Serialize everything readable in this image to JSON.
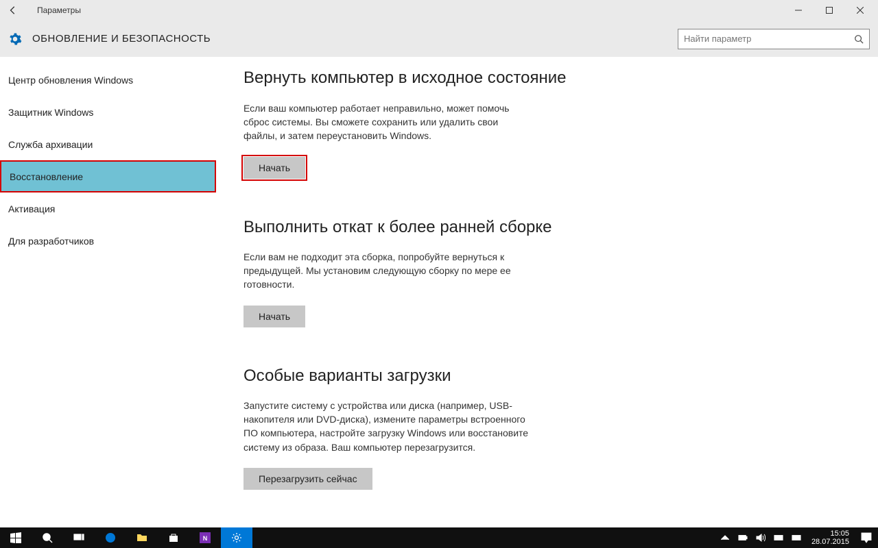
{
  "titlebar": {
    "title": "Параметры"
  },
  "header": {
    "title": "ОБНОВЛЕНИЕ И БЕЗОПАСНОСТЬ"
  },
  "search": {
    "placeholder": "Найти параметр"
  },
  "sidebar": {
    "items": [
      {
        "label": "Центр обновления Windows"
      },
      {
        "label": "Защитник Windows"
      },
      {
        "label": "Служба архивации"
      },
      {
        "label": "Восстановление"
      },
      {
        "label": "Активация"
      },
      {
        "label": "Для разработчиков"
      }
    ]
  },
  "sections": {
    "reset": {
      "title": "Вернуть компьютер в исходное состояние",
      "desc": "Если ваш компьютер работает неправильно, может помочь сброс системы. Вы сможете сохранить или удалить свои файлы, и затем переустановить Windows.",
      "button": "Начать"
    },
    "rollback": {
      "title": "Выполнить откат к более ранней сборке",
      "desc": "Если вам не подходит эта сборка, попробуйте вернуться к предыдущей. Мы установим следующую сборку по мере ее готовности.",
      "button": "Начать"
    },
    "advanced": {
      "title": "Особые варианты загрузки",
      "desc": "Запустите систему с устройства или диска (например, USB-накопителя или DVD-диска), измените параметры встроенного ПО компьютера, настройте загрузку Windows или восстановите систему из образа. Ваш компьютер перезагрузится.",
      "button": "Перезагрузить сейчас"
    }
  },
  "clock": {
    "time": "15:05",
    "date": "28.07.2015"
  }
}
